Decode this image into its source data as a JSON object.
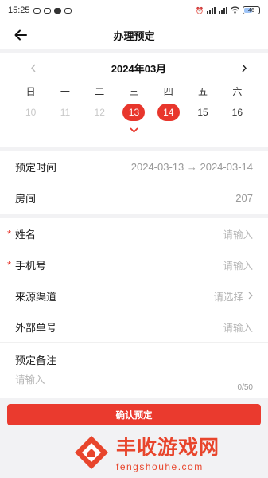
{
  "status_bar": {
    "time": "15:25",
    "battery": "46"
  },
  "nav": {
    "title": "办理预定"
  },
  "calendar": {
    "month": "2024年03月",
    "weekdays": [
      "日",
      "一",
      "二",
      "三",
      "四",
      "五",
      "六"
    ],
    "days": [
      {
        "label": "10",
        "state": "past"
      },
      {
        "label": "11",
        "state": "past"
      },
      {
        "label": "12",
        "state": "past"
      },
      {
        "label": "13",
        "state": "selected"
      },
      {
        "label": "14",
        "state": "selected"
      },
      {
        "label": "15",
        "state": "normal"
      },
      {
        "label": "16",
        "state": "normal"
      }
    ]
  },
  "booking": {
    "time_label": "预定时间",
    "time_value": "2024-03-13 → 2024-03-14",
    "room_label": "房间",
    "room_value": "207"
  },
  "form": {
    "required_mark": "*",
    "name_label": "姓名",
    "name_placeholder": "请输入",
    "phone_label": "手机号",
    "phone_placeholder": "请输入",
    "source_label": "来源渠道",
    "source_placeholder": "请选择",
    "external_label": "外部单号",
    "external_placeholder": "请输入",
    "remark_label": "预定备注",
    "remark_placeholder": "请输入",
    "remark_counter": "0/50"
  },
  "confirm_label": "确认预定",
  "watermark": {
    "title": "丰收游戏网",
    "url": "fengshouhe.com"
  },
  "colors": {
    "accent": "#e8362c",
    "watermark": "#e8452c"
  }
}
